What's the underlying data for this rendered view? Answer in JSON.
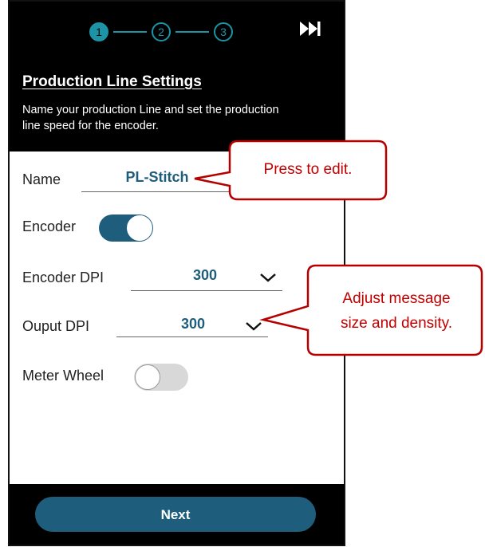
{
  "stepper": {
    "steps": [
      "1",
      "2",
      "3"
    ],
    "active_step": 1,
    "skip_icon": "skip-forward-icon"
  },
  "header": {
    "title": "Production Line Settings",
    "subtitle": "Name your production Line and set the production line speed for the encoder."
  },
  "form": {
    "name_label": "Name",
    "name_value": "PL-Stitch",
    "encoder_label": "Encoder",
    "encoder_enabled": true,
    "encoder_dpi_label": "Encoder DPI",
    "encoder_dpi_value": "300",
    "output_dpi_label": "Ouput DPI",
    "output_dpi_value": "300",
    "meter_wheel_label": "Meter Wheel",
    "meter_wheel_enabled": false
  },
  "footer": {
    "next_label": "Next"
  },
  "callouts": {
    "edit_hint": "Press to edit.",
    "dpi_hint_line1": "Adjust message",
    "dpi_hint_line2": "size and density."
  },
  "colors": {
    "accent": "#1e5d7c",
    "step_accent": "#1d93a6",
    "callout": "#c00000",
    "header_bg": "#000000"
  }
}
